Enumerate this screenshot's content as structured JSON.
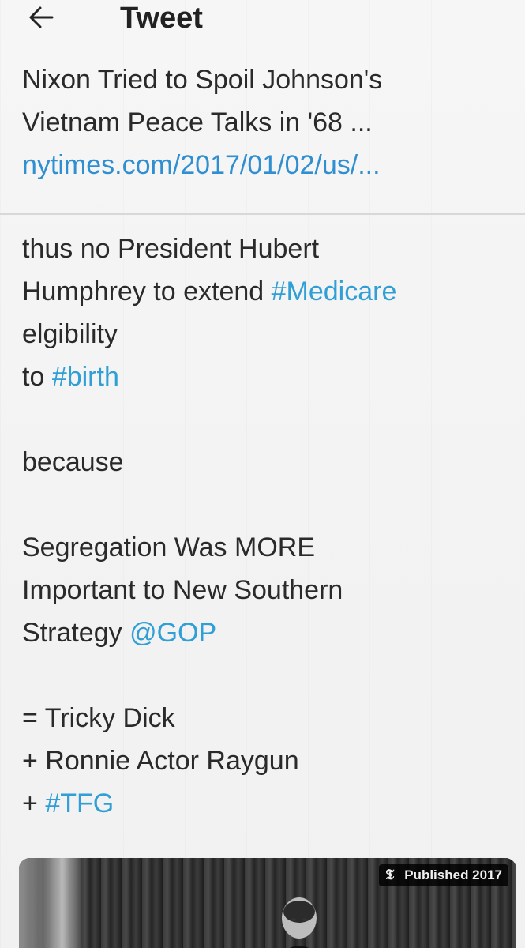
{
  "header": {
    "title": "Tweet",
    "back_icon": "arrow-left-icon"
  },
  "card": {
    "title_line1": "Nixon Tried to Spoil Johnson's",
    "title_line2": "Vietnam Peace Talks in '68 ...",
    "link": "nytimes.com/2017/01/02/us/..."
  },
  "tweet": {
    "l1": "thus no President Hubert",
    "l2_text": "Humphrey to extend ",
    "l2_tag": "#Medicare",
    "l3": "elgibility",
    "l4_text": "to ",
    "l4_tag": "#birth",
    "l5": "because",
    "l6": "Segregation Was MORE",
    "l7": "Important to New Southern",
    "l8_text": "Strategy ",
    "l8_mention": "@GOP",
    "l9": "= Tricky Dick",
    "l10": "+ Ronnie Actor Raygun",
    "l11_text": "+ ",
    "l11_tag": "#TFG"
  },
  "media": {
    "badge_logo": "𝕿",
    "badge_text": "Published 2017"
  },
  "colors": {
    "link": "#2f8fd0",
    "hashtag": "#2f9fd6",
    "text": "#2a2a2a"
  }
}
